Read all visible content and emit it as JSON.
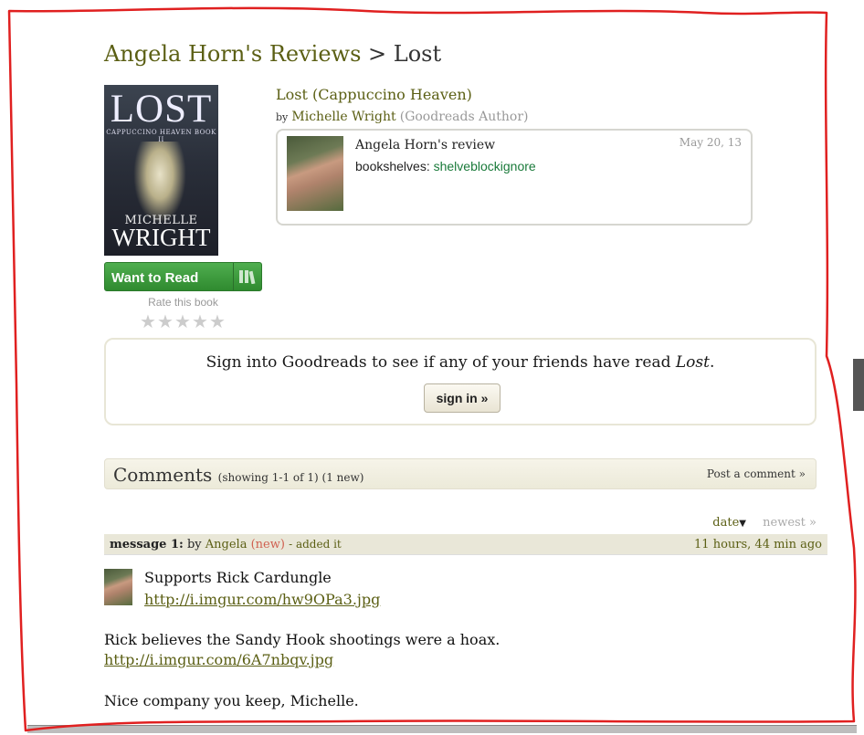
{
  "header": {
    "reviewer_link": "Angela Horn's Reviews",
    "separator": ">",
    "book_title": "Lost"
  },
  "cover": {
    "title": "LOST",
    "series_line": "CAPPUCCINO HEAVEN BOOK II",
    "author_first": "MICHELLE",
    "author_last": "WRIGHT"
  },
  "actions": {
    "want_to_read": "Want to Read",
    "rate_label": "Rate this book",
    "rating": 0,
    "rating_max": 5
  },
  "book": {
    "full_title": "Lost (Cappuccino Heaven)",
    "by": "by",
    "author": "Michelle Wright",
    "author_tag": "(Goodreads Author)"
  },
  "review": {
    "title": "Angela Horn's review",
    "shelves_label": "bookshelves:",
    "shelves_value": "shelveblockignore",
    "date": "May 20, 13"
  },
  "signin": {
    "text_prefix": "Sign into Goodreads to see if any of your friends have read ",
    "text_book": "Lost",
    "text_suffix": ".",
    "button": "sign in »"
  },
  "comments": {
    "heading": "Comments",
    "showing": "(showing 1-1 of 1) (1 new)",
    "post": "Post a comment »",
    "sort_date": "date",
    "sort_newest": "newest »"
  },
  "message": {
    "number": "message 1:",
    "by": "by",
    "user": "Angela",
    "new_tag": "(new)",
    "added": "- added it",
    "time": "11 hours, 44 min ago",
    "line1": "Supports Rick Cardungle",
    "link1": "http://i.imgur.com/hw9OPa3.jpg",
    "line2": "Rick believes the Sandy Hook shootings were a hoax.",
    "link2": "http://i.imgur.com/6A7nbqv.jpg",
    "line3": "Nice company you keep, Michelle."
  },
  "colors": {
    "link_olive": "#5b5f14",
    "button_green": "#3e9c3e",
    "annotation_red": "#e02020"
  }
}
